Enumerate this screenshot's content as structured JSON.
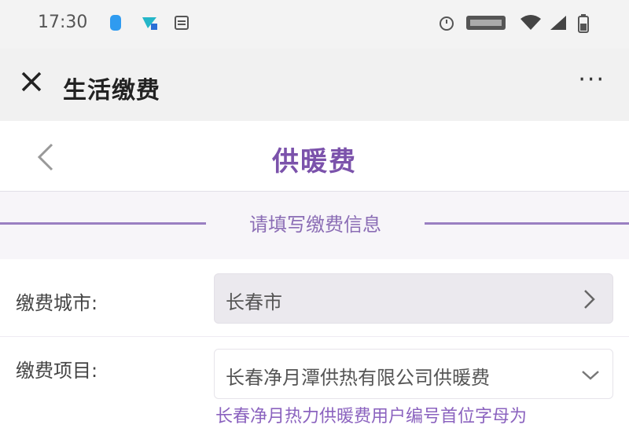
{
  "status_bar": {
    "time": "17:30",
    "icons": [
      "notification-icon",
      "app-icon",
      "message-icon",
      "alarm-icon",
      "battery-saver-icon",
      "wifi-icon",
      "signal-icon",
      "battery-icon"
    ]
  },
  "wechat_bar": {
    "title": "生活缴费",
    "more": "···"
  },
  "header": {
    "title": "供暖费"
  },
  "section": {
    "title": "请填写缴费信息"
  },
  "form": {
    "city_label": "缴费城市:",
    "city_value": "长春市",
    "item_label": "缴费项目:",
    "item_value": "长春净月潭供热有限公司供暖费",
    "hint": "长春净月热力供暖费用户编号首位字母为"
  },
  "colors": {
    "accent": "#7b52ab",
    "line": "#9a7fc2"
  }
}
